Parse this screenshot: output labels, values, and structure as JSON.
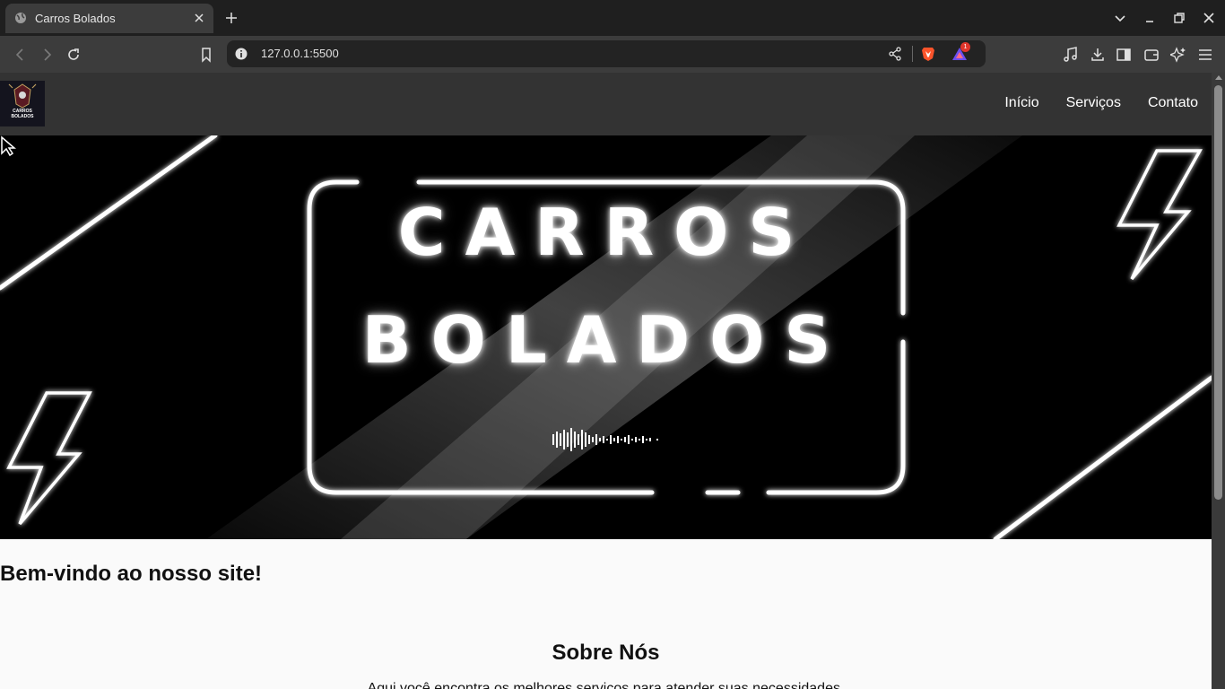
{
  "browser": {
    "tab_title": "Carros Bolados",
    "url": "127.0.0.1:5500",
    "rewards_badge": "1"
  },
  "site": {
    "logo_text_line1": "CARROS",
    "logo_text_line2": "BOLADOS",
    "nav": [
      "Início",
      "Serviços",
      "Contato"
    ],
    "hero": {
      "line1": "CARROS",
      "line2": "BOLADOS"
    },
    "welcome": "Bem-vindo ao nosso site!",
    "about_title": "Sobre Nós",
    "about_text": "Aqui você encontra os melhores serviços para atender suas necessidades."
  },
  "colors": {
    "header_bg": "#333333",
    "page_bg": "#fafafa",
    "hero_bg": "#000000",
    "neon": "#ffffff"
  }
}
